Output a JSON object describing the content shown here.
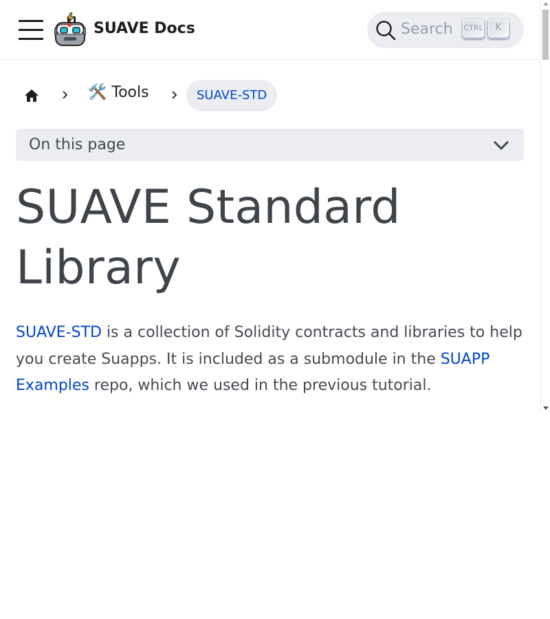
{
  "navbar": {
    "brand": "SUAVE Docs",
    "search_placeholder": "Search",
    "shortcut_ctrl": "CTRL",
    "shortcut_key": "K"
  },
  "breadcrumbs": {
    "home_icon": "home-icon",
    "tools_label": "🛠️ Tools",
    "current_label": "SUAVE-STD"
  },
  "toc": {
    "label": "On this page"
  },
  "article": {
    "title": "SUAVE Standard Library",
    "para_link1": "SUAVE-STD",
    "para_text1": " is a collection of Solidity contracts and libraries to help you create Suapps. It is included as a submodule in the ",
    "para_link2": "SUAPP Examples",
    "para_text2": " repo, which we used in the previous tutorial."
  },
  "colors": {
    "link": "#0046cc",
    "text": "#444950",
    "surface": "#ebedf0"
  }
}
